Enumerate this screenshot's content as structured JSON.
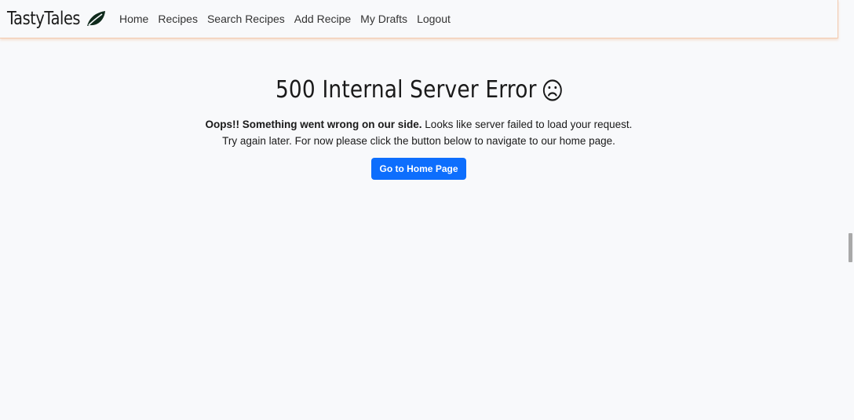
{
  "navbar": {
    "brand": "TastyTales",
    "links": [
      "Home",
      "Recipes",
      "Search Recipes",
      "Add Recipe",
      "My Drafts",
      "Logout"
    ]
  },
  "error": {
    "title": "500 Internal Server Error",
    "icon": "frown-face-icon",
    "message_bold": "Oops!! Something went wrong on our side.",
    "message_rest": " Looks like server failed to load your request.",
    "message_line2": "Try again later. For now please click the button below to navigate to our home page.",
    "button_label": "Go to Home Page"
  },
  "colors": {
    "background": "#f8f9fb",
    "accent": "#0d6efd",
    "navbar_border": "#f2c9ae",
    "brand_leaf": "#0f2a1c"
  }
}
